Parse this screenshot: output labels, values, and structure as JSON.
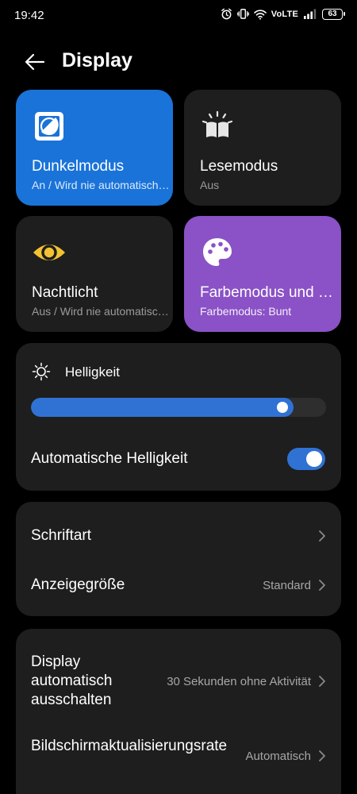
{
  "status_bar": {
    "time": "19:42",
    "network": "VoLTE",
    "battery": "63"
  },
  "header": {
    "title": "Display"
  },
  "tiles": [
    {
      "label": "Dunkelmodus",
      "sub": "An / Wird nie automatisch ausgeschaltet",
      "icon": "dark-mode-icon",
      "color": "#1a73d9",
      "active": true
    },
    {
      "label": "Lesemodus",
      "sub": "Aus",
      "icon": "reading-mode-icon",
      "color": "#1e1e1e",
      "active": false
    },
    {
      "label": "Nachtlicht",
      "sub": "Aus / Wird nie automatisch eingeschaltet",
      "icon": "eye-icon",
      "color": "#1e1e1e",
      "active": false
    },
    {
      "label": "Farbemodus und Farbtemperatur",
      "sub": "Farbemodus: Bunt",
      "icon": "palette-icon",
      "color": "#8a52c6",
      "active": true
    }
  ],
  "brightness": {
    "title": "Helligkeit",
    "level_percent": 89,
    "auto_label": "Automatische Helligkeit",
    "auto_enabled": true
  },
  "font_section": {
    "font_label": "Schriftart",
    "size_label": "Anzeigegröße",
    "size_value": "Standard"
  },
  "screen_section": {
    "timeout_label": "Display automatisch ausschalten",
    "timeout_value": "30 Sekunden ohne Aktivität",
    "refresh_label": "Bildschirmaktualisierungsrate",
    "refresh_value": "Automatisch"
  },
  "colors": {
    "accent": "#2f72d4",
    "card": "#1e1e1e",
    "background": "#000000",
    "eye_icon": "#f2c233"
  }
}
